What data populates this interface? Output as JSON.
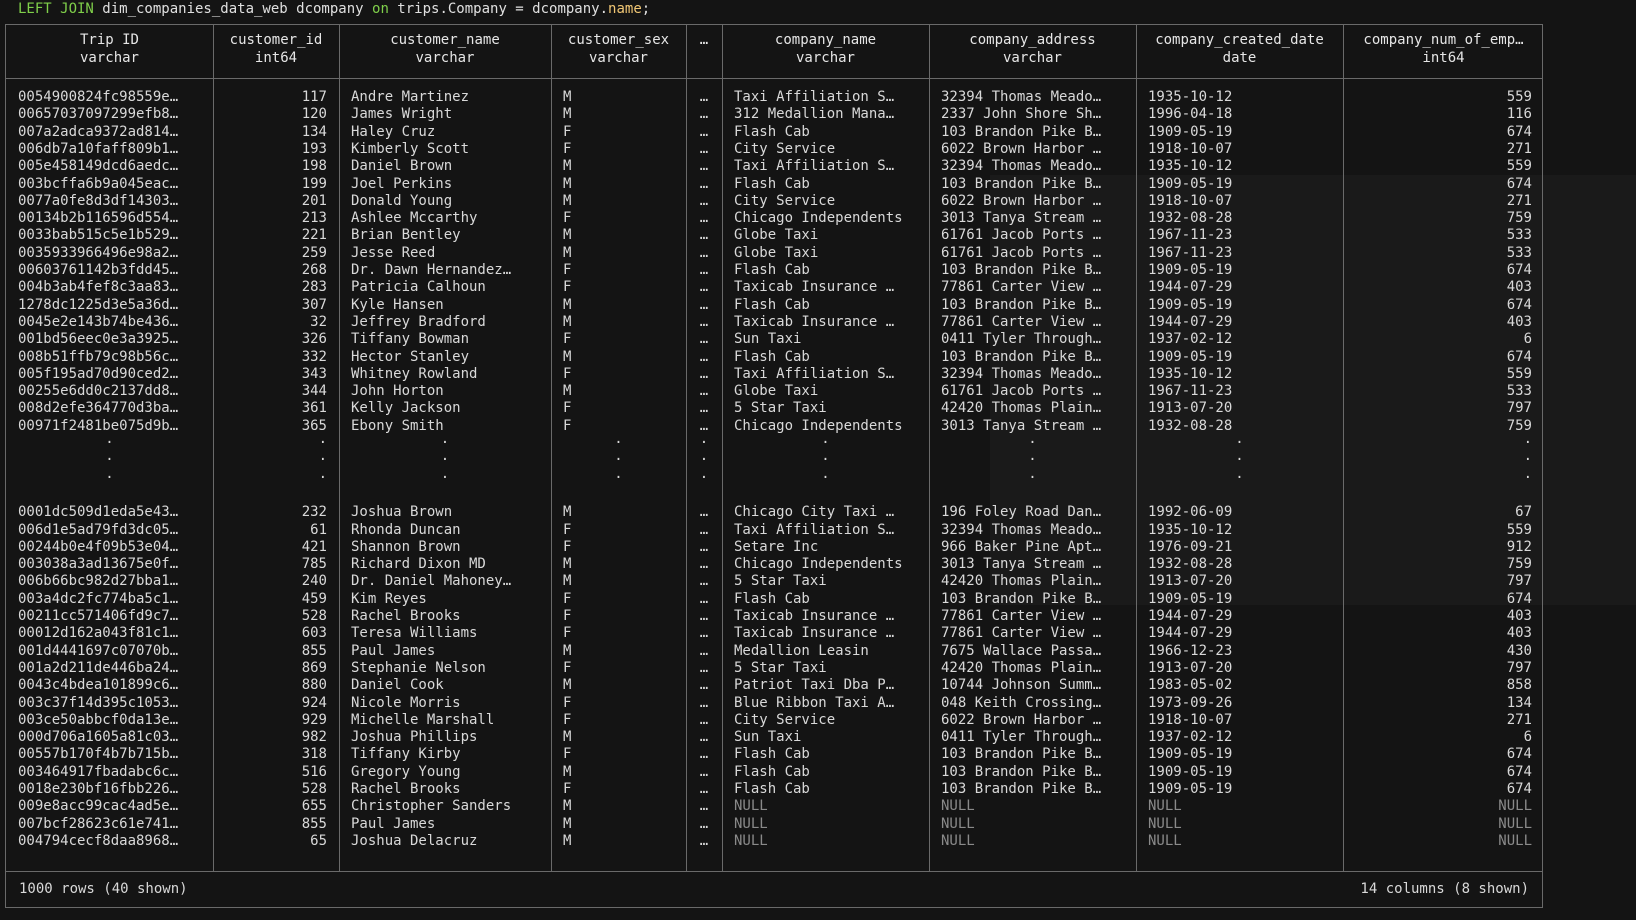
{
  "sql_line": {
    "kw": "LEFT JOIN",
    "mid": " dim_companies_data_web dcompany ",
    "on": "on",
    "rest": " trips.Company = dcompany.",
    "prop": "name",
    "end": ";"
  },
  "columns": [
    {
      "name": "Trip ID",
      "type": "varchar"
    },
    {
      "name": "customer_id",
      "type": "int64"
    },
    {
      "name": "customer_name",
      "type": "varchar"
    },
    {
      "name": "customer_sex",
      "type": "varchar"
    },
    {
      "name": "…",
      "type": ""
    },
    {
      "name": "company_name",
      "type": "varchar"
    },
    {
      "name": "company_address",
      "type": "varchar"
    },
    {
      "name": "company_created_date",
      "type": "date"
    },
    {
      "name": "company_num_of_emp…",
      "type": "int64"
    }
  ],
  "rows_top": [
    [
      "0054900824fc98559e…",
      "117",
      "Andre Martinez",
      "M",
      "…",
      "Taxi Affiliation S…",
      "32394 Thomas Meado…",
      "1935-10-12",
      "559"
    ],
    [
      "00657037097299efb8…",
      "120",
      "James Wright",
      "M",
      "…",
      "312 Medallion Mana…",
      "2337 John Shore Sh…",
      "1996-04-18",
      "116"
    ],
    [
      "007a2adca9372ad814…",
      "134",
      "Haley Cruz",
      "F",
      "…",
      "Flash Cab",
      "103 Brandon Pike B…",
      "1909-05-19",
      "674"
    ],
    [
      "006db7a10faff809b1…",
      "193",
      "Kimberly Scott",
      "F",
      "…",
      "City Service",
      "6022 Brown Harbor …",
      "1918-10-07",
      "271"
    ],
    [
      "005e458149dcd6aedc…",
      "198",
      "Daniel Brown",
      "M",
      "…",
      "Taxi Affiliation S…",
      "32394 Thomas Meado…",
      "1935-10-12",
      "559"
    ],
    [
      "003bcffa6b9a045eac…",
      "199",
      "Joel Perkins",
      "M",
      "…",
      "Flash Cab",
      "103 Brandon Pike B…",
      "1909-05-19",
      "674"
    ],
    [
      "0077a0fe8d3df14303…",
      "201",
      "Donald Young",
      "M",
      "…",
      "City Service",
      "6022 Brown Harbor …",
      "1918-10-07",
      "271"
    ],
    [
      "00134b2b116596d554…",
      "213",
      "Ashlee Mccarthy",
      "F",
      "…",
      "Chicago Independents",
      "3013 Tanya Stream …",
      "1932-08-28",
      "759"
    ],
    [
      "0033bab515c5e1b529…",
      "221",
      "Brian Bentley",
      "M",
      "…",
      "Globe Taxi",
      "61761 Jacob Ports …",
      "1967-11-23",
      "533"
    ],
    [
      "0035933966496e98a2…",
      "259",
      "Jesse Reed",
      "M",
      "…",
      "Globe Taxi",
      "61761 Jacob Ports …",
      "1967-11-23",
      "533"
    ],
    [
      "00603761142b3fdd45…",
      "268",
      "Dr. Dawn Hernandez…",
      "F",
      "…",
      "Flash Cab",
      "103 Brandon Pike B…",
      "1909-05-19",
      "674"
    ],
    [
      "004b3ab4fef8c3aa83…",
      "283",
      "Patricia Calhoun",
      "F",
      "…",
      "Taxicab Insurance …",
      "77861 Carter View …",
      "1944-07-29",
      "403"
    ],
    [
      "1278dc1225d3e5a36d…",
      "307",
      "Kyle Hansen",
      "M",
      "…",
      "Flash Cab",
      "103 Brandon Pike B…",
      "1909-05-19",
      "674"
    ],
    [
      "0045e2e143b74be436…",
      "32",
      "Jeffrey Bradford",
      "M",
      "…",
      "Taxicab Insurance …",
      "77861 Carter View …",
      "1944-07-29",
      "403"
    ],
    [
      "001bd56eec0e3a3925…",
      "326",
      "Tiffany Bowman",
      "F",
      "…",
      "Sun Taxi",
      "0411 Tyler Through…",
      "1937-02-12",
      "6"
    ],
    [
      "008b51ffb79c98b56c…",
      "332",
      "Hector Stanley",
      "M",
      "…",
      "Flash Cab",
      "103 Brandon Pike B…",
      "1909-05-19",
      "674"
    ],
    [
      "005f195ad70d90ced2…",
      "343",
      "Whitney Rowland",
      "F",
      "…",
      "Taxi Affiliation S…",
      "32394 Thomas Meado…",
      "1935-10-12",
      "559"
    ],
    [
      "00255e6dd0c2137dd8…",
      "344",
      "John Horton",
      "M",
      "…",
      "Globe Taxi",
      "61761 Jacob Ports …",
      "1967-11-23",
      "533"
    ],
    [
      "008d2efe364770d3ba…",
      "361",
      "Kelly Jackson",
      "F",
      "…",
      "5 Star Taxi",
      "42420 Thomas Plain…",
      "1913-07-20",
      "797"
    ],
    [
      "00971f2481be075d9b…",
      "365",
      "Ebony Smith",
      "F",
      "…",
      "Chicago Independents",
      "3013 Tanya Stream …",
      "1932-08-28",
      "759"
    ]
  ],
  "ellipsis_dot": "·",
  "rows_bottom": [
    [
      "0001dc509d1eda5e43…",
      "232",
      "Joshua Brown",
      "M",
      "…",
      "Chicago City Taxi …",
      "196 Foley Road Dan…",
      "1992-06-09",
      "67"
    ],
    [
      "006d1e5ad79fd3dc05…",
      "61",
      "Rhonda Duncan",
      "F",
      "…",
      "Taxi Affiliation S…",
      "32394 Thomas Meado…",
      "1935-10-12",
      "559"
    ],
    [
      "00244b0e4f09b53e04…",
      "421",
      "Shannon Brown",
      "F",
      "…",
      "Setare Inc",
      "966 Baker Pine Apt…",
      "1976-09-21",
      "912"
    ],
    [
      "003038a3ad13675e0f…",
      "785",
      "Richard Dixon MD",
      "M",
      "…",
      "Chicago Independents",
      "3013 Tanya Stream …",
      "1932-08-28",
      "759"
    ],
    [
      "006b66bc982d27bba1…",
      "240",
      "Dr. Daniel Mahoney…",
      "M",
      "…",
      "5 Star Taxi",
      "42420 Thomas Plain…",
      "1913-07-20",
      "797"
    ],
    [
      "003a4dc2fc774ba5c1…",
      "459",
      "Kim Reyes",
      "F",
      "…",
      "Flash Cab",
      "103 Brandon Pike B…",
      "1909-05-19",
      "674"
    ],
    [
      "00211cc571406fd9c7…",
      "528",
      "Rachel Brooks",
      "F",
      "…",
      "Taxicab Insurance …",
      "77861 Carter View …",
      "1944-07-29",
      "403"
    ],
    [
      "00012d162a043f81c1…",
      "603",
      "Teresa Williams",
      "F",
      "…",
      "Taxicab Insurance …",
      "77861 Carter View …",
      "1944-07-29",
      "403"
    ],
    [
      "001d4441697c07070b…",
      "855",
      "Paul James",
      "M",
      "…",
      "Medallion Leasin",
      "7675 Wallace Passa…",
      "1966-12-23",
      "430"
    ],
    [
      "001a2d211de446ba24…",
      "869",
      "Stephanie Nelson",
      "F",
      "…",
      "5 Star Taxi",
      "42420 Thomas Plain…",
      "1913-07-20",
      "797"
    ],
    [
      "0043c4bdea101899c6…",
      "880",
      "Daniel Cook",
      "M",
      "…",
      "Patriot Taxi Dba P…",
      "10744 Johnson Summ…",
      "1983-05-02",
      "858"
    ],
    [
      "003c37f14d395c1053…",
      "924",
      "Nicole Morris",
      "F",
      "…",
      "Blue Ribbon Taxi A…",
      "048 Keith Crossing…",
      "1973-09-26",
      "134"
    ],
    [
      "003ce50abbcf0da13e…",
      "929",
      "Michelle Marshall",
      "F",
      "…",
      "City Service",
      "6022 Brown Harbor …",
      "1918-10-07",
      "271"
    ],
    [
      "000d706a1605a81c03…",
      "982",
      "Joshua Phillips",
      "M",
      "…",
      "Sun Taxi",
      "0411 Tyler Through…",
      "1937-02-12",
      "6"
    ],
    [
      "00557b170f4b7b715b…",
      "318",
      "Tiffany Kirby",
      "F",
      "…",
      "Flash Cab",
      "103 Brandon Pike B…",
      "1909-05-19",
      "674"
    ],
    [
      "003464917fbadabc6c…",
      "516",
      "Gregory Young",
      "M",
      "…",
      "Flash Cab",
      "103 Brandon Pike B…",
      "1909-05-19",
      "674"
    ],
    [
      "0018e230bf16fbb226…",
      "528",
      "Rachel Brooks",
      "F",
      "…",
      "Flash Cab",
      "103 Brandon Pike B…",
      "1909-05-19",
      "674"
    ],
    [
      "009e8acc99cac4ad5e…",
      "655",
      "Christopher Sanders",
      "M",
      "…",
      "NULL",
      "NULL",
      "NULL",
      "NULL"
    ],
    [
      "007bcf28623c61e741…",
      "855",
      "Paul James",
      "M",
      "…",
      "NULL",
      "NULL",
      "NULL",
      "NULL"
    ],
    [
      "004794cecf8daa8968…",
      "65",
      "Joshua Delacruz",
      "M",
      "…",
      "NULL",
      "NULL",
      "NULL",
      "NULL"
    ]
  ],
  "footer": {
    "rows_info": "1000 rows (40 shown)",
    "cols_info": "14 columns (8 shown)"
  },
  "colors": {
    "background": "#141414",
    "keyword": "#7fcf4a",
    "property": "#f0c674",
    "border": "#6a6a6a",
    "null_text": "#8a8a8a"
  }
}
